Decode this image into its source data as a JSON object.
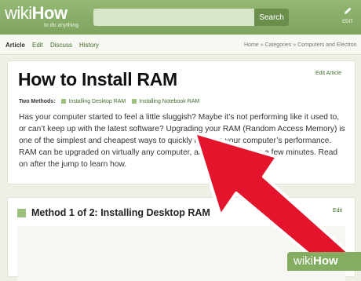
{
  "header": {
    "logo_wiki": "wiki",
    "logo_how": "How",
    "tagline": "to do anything",
    "search_placeholder": "",
    "search_button": "Search",
    "edit_label": "EDIT"
  },
  "nav": {
    "tabs": [
      "Article",
      "Edit",
      "Discuss",
      "History"
    ],
    "breadcrumb": "Home » Categories » Computers and Electron"
  },
  "article": {
    "title": "How to Install RAM",
    "edit_link": "Edit Article",
    "methods_label": "Two Methods:",
    "methods": [
      "Installing Desktop RAM",
      "Installing Notebook RAM"
    ],
    "intro": "Has your computer started to feel a little sluggish? Maybe it’s not performing like it used to, or can’t keep up with the latest software? Upgrading your RAM (Random Access Memory) is one of the simplest and cheapest ways to quickly improve your computer’s performance. RAM can be upgraded on virtually any computer, and only takes a sc          a few minutes. Read on after the jump to learn how."
  },
  "section": {
    "title": "Method 1 of 2: Installing Desktop RAM",
    "edit_link": "Edit"
  },
  "watermark": {
    "wiki": "wiki",
    "how": "How"
  },
  "colors": {
    "brand_green": "#84ad62",
    "link_green": "#3f6d2c",
    "arrow_red": "#e3142b"
  }
}
